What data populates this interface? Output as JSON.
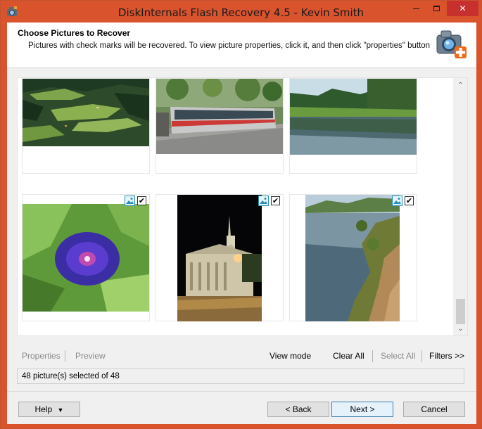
{
  "window": {
    "title": "DiskInternals Flash Recovery 4.5 - Kevin Smith",
    "controls": {
      "minimize": "",
      "maximize": "",
      "close": "✕"
    }
  },
  "header": {
    "title": "Choose Pictures to Recover",
    "subtitle": "Pictures with check marks will be recovered. To view picture properties, click it, and then click \"properties\" button"
  },
  "gallery": {
    "items": [
      {
        "name": "hillside-farmland",
        "checked": false
      },
      {
        "name": "red-tram",
        "checked": false
      },
      {
        "name": "lake-reflection",
        "checked": false
      },
      {
        "name": "purple-flower",
        "checked": true
      },
      {
        "name": "building-at-night",
        "checked": true
      },
      {
        "name": "rocky-coastline",
        "checked": true
      }
    ],
    "check_glyph": "✔"
  },
  "scrollbar": {
    "up": "⌃",
    "down": "⌄"
  },
  "toolbar": {
    "properties": "Properties",
    "preview": "Preview",
    "view_mode": "View mode",
    "clear_all": "Clear All",
    "select_all": "Select All",
    "filters": "Filters >>"
  },
  "status": "48 picture(s) selected of 48",
  "buttons": {
    "help": "Help",
    "back": "< Back",
    "next": "Next >",
    "cancel": "Cancel"
  },
  "colors": {
    "titlebar": "#d9532d",
    "close": "#c7302c",
    "primary_border": "#3c7fb1"
  }
}
